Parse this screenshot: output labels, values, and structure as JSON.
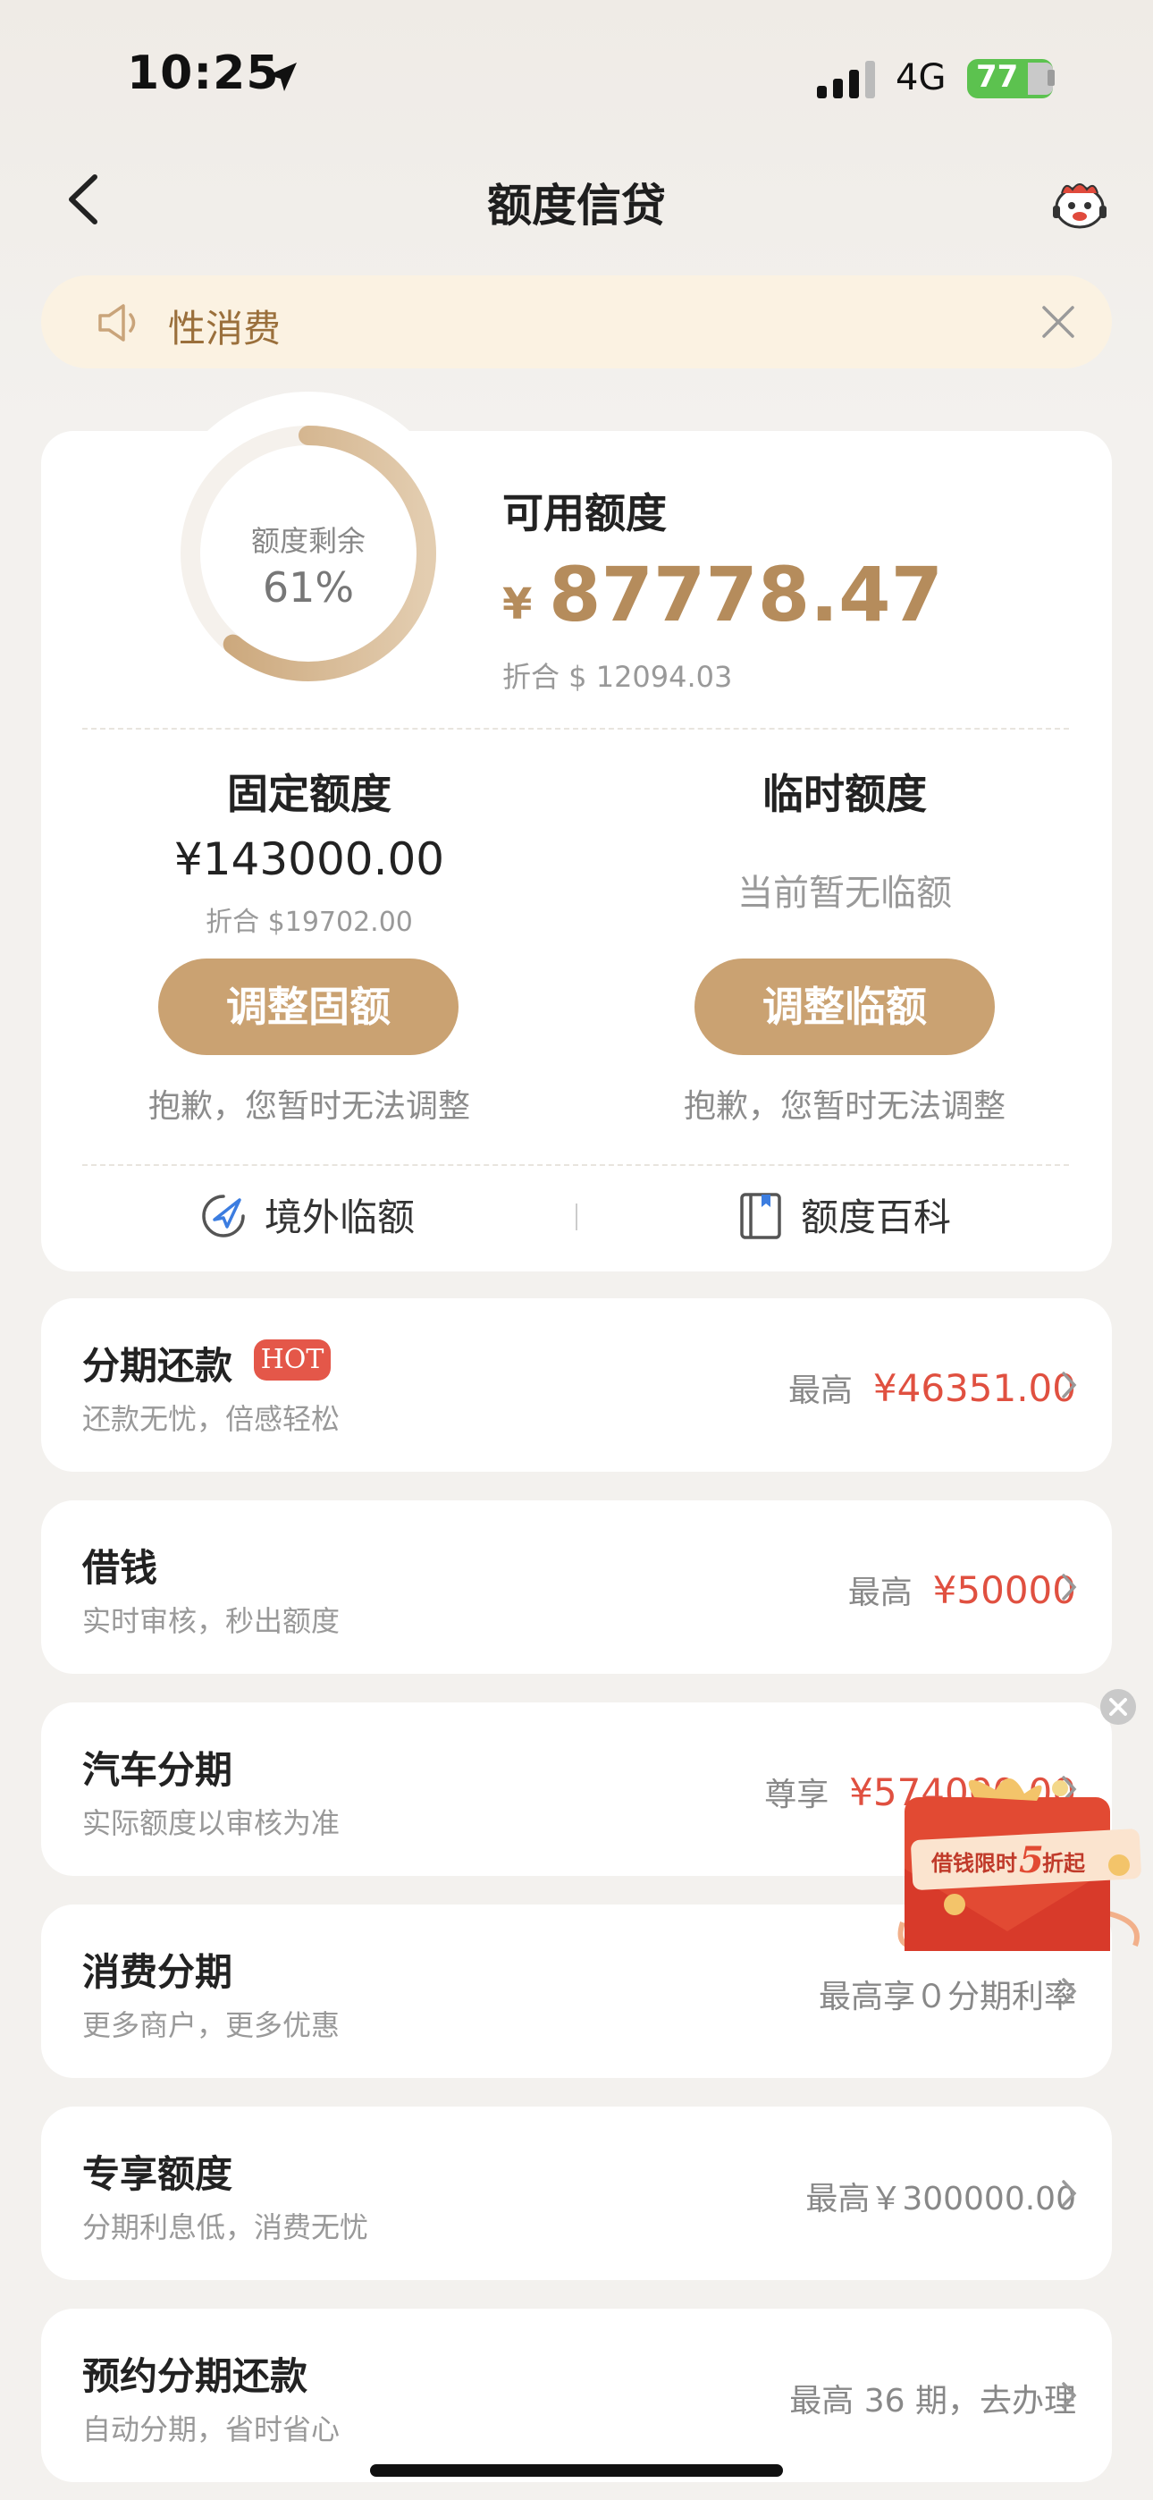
{
  "status_bar": {
    "time": "10:25",
    "network": "4G",
    "battery": "77"
  },
  "nav": {
    "title": "额度信贷"
  },
  "notice": {
    "text": "性消费"
  },
  "quota": {
    "ring_label": "额度剩余",
    "ring_percent": "61%",
    "ring_fraction": 0.61,
    "available_title": "可用额度",
    "available_yen": "¥",
    "available_amount": "87778.47",
    "available_usd": "折合 $ 12094.03",
    "fixed": {
      "title": "固定额度",
      "amount": "¥143000.00",
      "usd": "折合 $19702.00",
      "button": "调整固额",
      "note": "抱歉，您暂时无法调整"
    },
    "temp": {
      "title": "临时额度",
      "none_text": "当前暂无临额",
      "button": "调整临额",
      "note": "抱歉，您暂时无法调整"
    },
    "tools": {
      "overseas": "境外临额",
      "wiki": "额度百科"
    }
  },
  "list": [
    {
      "title": "分期还款",
      "badge": "HOT",
      "subtitle": "还款无忧，倍感轻松",
      "prefix": "最高",
      "value": "¥46351.00"
    },
    {
      "title": "借钱",
      "subtitle": "实时审核，秒出额度",
      "prefix": "最高",
      "value": "¥50000"
    },
    {
      "title": "汽车分期",
      "subtitle": "实际额度以审核为准",
      "prefix": "尊享",
      "value": "¥574000.00"
    },
    {
      "title": "消费分期",
      "subtitle": "更多商户，更多优惠",
      "prefix": "最高享０分期利率",
      "value": ""
    },
    {
      "title": "专享额度",
      "subtitle": "分期利息低，消费无忧",
      "prefix": "最高￥300000.00",
      "value": ""
    },
    {
      "title": "预约分期还款",
      "subtitle": "自动分期，省时省心",
      "prefix": "最高 36 期，去办理",
      "value": ""
    }
  ],
  "ad": {
    "text_before": "借钱限时",
    "highlight": "5",
    "text_after": "折起"
  },
  "colors": {
    "accent": "#caa272",
    "gold_text": "#b58c5c",
    "red": "#e05040",
    "hot_badge": "#e45749"
  }
}
